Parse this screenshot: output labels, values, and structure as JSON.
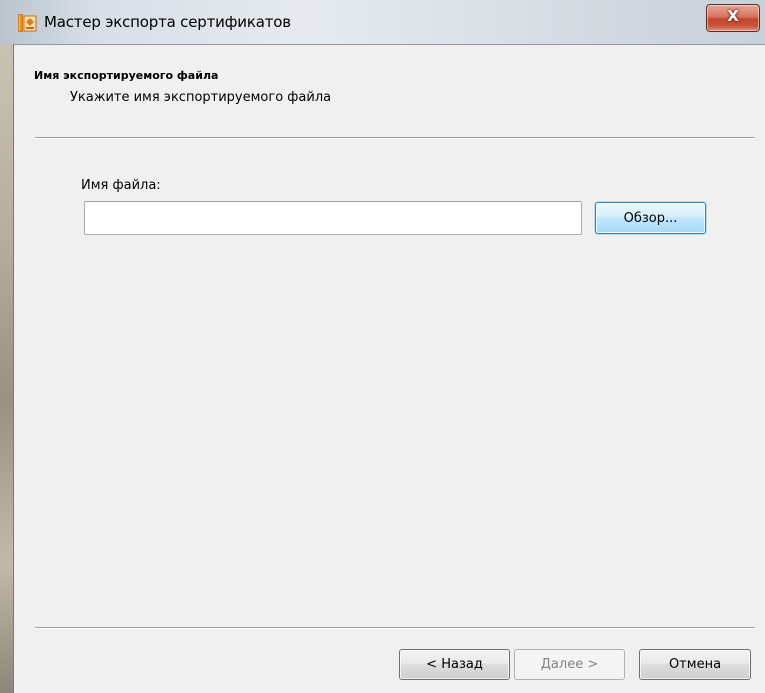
{
  "window": {
    "title": "Мастер экспорта сертификатов",
    "close_label": "X",
    "icon": "certificate-wizard-icon"
  },
  "header": {
    "title": "Имя экспортируемого файла",
    "subtitle": "Укажите имя экспортируемого файла"
  },
  "form": {
    "filename_label": "Имя файла:",
    "filename_value": "",
    "browse_label": "Обзор..."
  },
  "footer": {
    "back_label": "< Назад",
    "next_label": "Далее >",
    "cancel_label": "Отмена"
  },
  "colors": {
    "close_button": "#c2452c",
    "browse_focus": "#3c7fb1",
    "dialog_background": "#f0f0f0"
  }
}
